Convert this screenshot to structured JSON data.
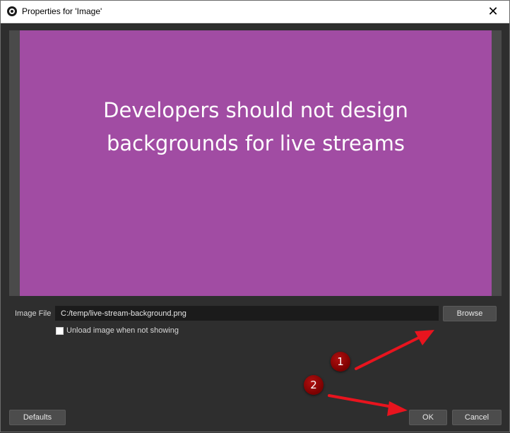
{
  "window": {
    "title": "Properties for 'Image'",
    "close_glyph": "✕"
  },
  "preview": {
    "line1": "Developers should not design",
    "line2": "backgrounds for live streams",
    "frame_color": "#4a4a4a",
    "image_color": "#a14ca3"
  },
  "image_file": {
    "label": "Image File",
    "value": "C:/temp/live-stream-background.png",
    "browse_label": "Browse"
  },
  "unload_option": {
    "label": "Unload image when not showing",
    "checked": false
  },
  "footer": {
    "defaults_label": "Defaults",
    "ok_label": "OK",
    "cancel_label": "Cancel"
  },
  "annotations": {
    "markers": [
      {
        "label": "1"
      },
      {
        "label": "2"
      }
    ],
    "arrow_color": "#e8141e"
  }
}
